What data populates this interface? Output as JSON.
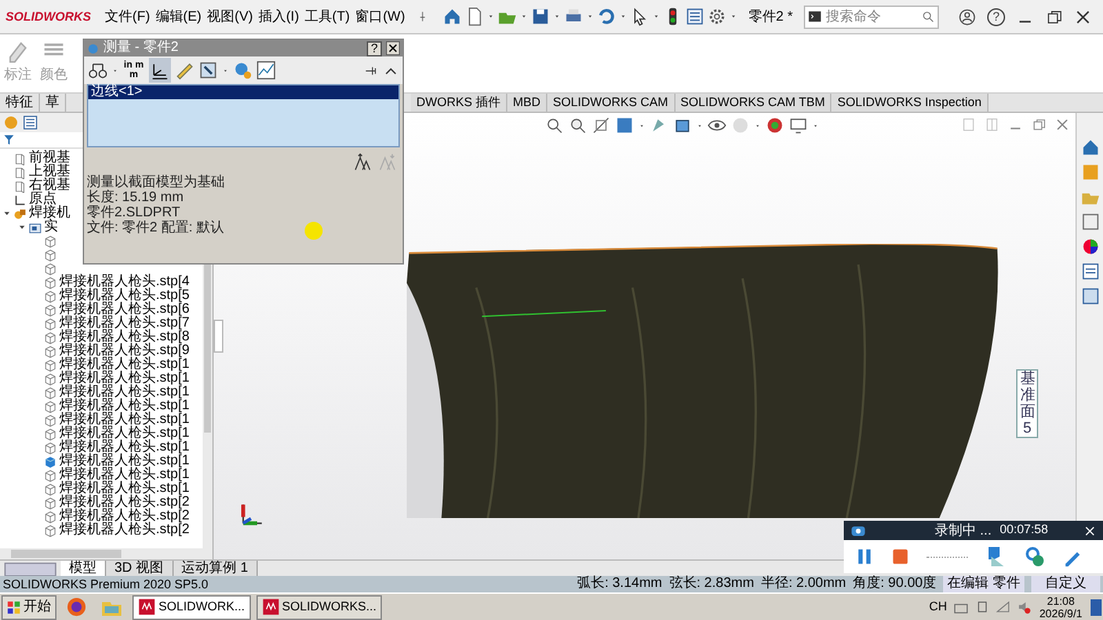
{
  "app": {
    "logo": "SOLIDWORKS",
    "menus": [
      "文件(F)",
      "编辑(E)",
      "视图(V)",
      "插入(I)",
      "工具(T)",
      "窗口(W)"
    ],
    "title": "零件2 *",
    "help_label": "?",
    "search": {
      "placeholder": "搜索命令"
    }
  },
  "command_manager": {
    "buttons": [
      "标注",
      "颜色"
    ]
  },
  "tabs": {
    "left": [
      "特征",
      "草"
    ],
    "right": [
      "DWORKS 插件",
      "MBD",
      "SOLIDWORKS CAM",
      "SOLIDWORKS CAM TBM",
      "SOLIDWORKS Inspection"
    ]
  },
  "tree": [
    {
      "kind": "plane",
      "label": "前视基"
    },
    {
      "kind": "plane",
      "label": "上视基"
    },
    {
      "kind": "plane",
      "label": "右视基"
    },
    {
      "kind": "origin",
      "label": "原点"
    },
    {
      "kind": "part",
      "label": "焊接机",
      "expanded": true,
      "children": [
        {
          "kind": "folder",
          "label": "实",
          "expanded": true,
          "children": [
            {
              "kind": "body",
              "selected": false
            },
            {
              "kind": "body",
              "selected": false
            },
            {
              "kind": "body",
              "selected": false
            },
            {
              "kind": "body",
              "label": "焊接机器人枪头.stp[4",
              "selected": false
            },
            {
              "kind": "body",
              "label": "焊接机器人枪头.stp[5",
              "selected": false
            },
            {
              "kind": "body",
              "label": "焊接机器人枪头.stp[6",
              "selected": false
            },
            {
              "kind": "body",
              "label": "焊接机器人枪头.stp[7",
              "selected": false
            },
            {
              "kind": "body",
              "label": "焊接机器人枪头.stp[8",
              "selected": false
            },
            {
              "kind": "body",
              "label": "焊接机器人枪头.stp[9",
              "selected": false
            },
            {
              "kind": "body",
              "label": "焊接机器人枪头.stp[1",
              "selected": false
            },
            {
              "kind": "body",
              "label": "焊接机器人枪头.stp[1",
              "selected": false
            },
            {
              "kind": "body",
              "label": "焊接机器人枪头.stp[1",
              "selected": false
            },
            {
              "kind": "body",
              "label": "焊接机器人枪头.stp[1",
              "selected": false
            },
            {
              "kind": "body",
              "label": "焊接机器人枪头.stp[1",
              "selected": false
            },
            {
              "kind": "body",
              "label": "焊接机器人枪头.stp[1",
              "selected": false
            },
            {
              "kind": "body",
              "label": "焊接机器人枪头.stp[1",
              "selected": false
            },
            {
              "kind": "body",
              "label": "焊接机器人枪头.stp[1",
              "selected": true
            },
            {
              "kind": "body",
              "label": "焊接机器人枪头.stp[1",
              "selected": false
            },
            {
              "kind": "body",
              "label": "焊接机器人枪头.stp[1",
              "selected": false
            },
            {
              "kind": "body",
              "label": "焊接机器人枪头.stp[2",
              "selected": false
            },
            {
              "kind": "body",
              "label": "焊接机器人枪头.stp[2",
              "selected": false
            },
            {
              "kind": "body",
              "label": "焊接机器人枪头.stp[2",
              "selected": false
            }
          ]
        }
      ]
    }
  ],
  "bottom_tabs": [
    {
      "label": "模型",
      "selected": true
    },
    {
      "label": "3D 视图",
      "selected": false
    },
    {
      "label": "运动算例 1",
      "selected": false
    }
  ],
  "measure_dialog": {
    "title": "测量 - 零件2",
    "help_label": "?",
    "unit_label": "in mm",
    "selections": [
      {
        "label": "边线<1>",
        "selected": true
      }
    ],
    "results": [
      "测量以截面模型为基础",
      "长度: 15.19 mm",
      "零件2.SLDPRT",
      "文件: 零件2 配置: 默认"
    ]
  },
  "annotation": "基准面5",
  "recorder": {
    "status": "录制中 ...",
    "time": "00:07:58"
  },
  "status_bar": {
    "product": "SOLIDWORKS Premium 2020 SP5.0",
    "readouts": [
      "弧长: 3.14mm",
      "弦长: 2.83mm",
      "半径: 2.00mm",
      "角度: 90.00度"
    ],
    "mode": "在编辑 零件",
    "units": "自定义"
  },
  "taskbar": {
    "start": "开始",
    "tasks": [
      {
        "label": "SOLIDWORK...",
        "selected": true
      },
      {
        "label": "SOLIDWORKS...",
        "selected": false
      }
    ],
    "language": "CH",
    "time": "21:08",
    "date": "2026/9/1"
  }
}
